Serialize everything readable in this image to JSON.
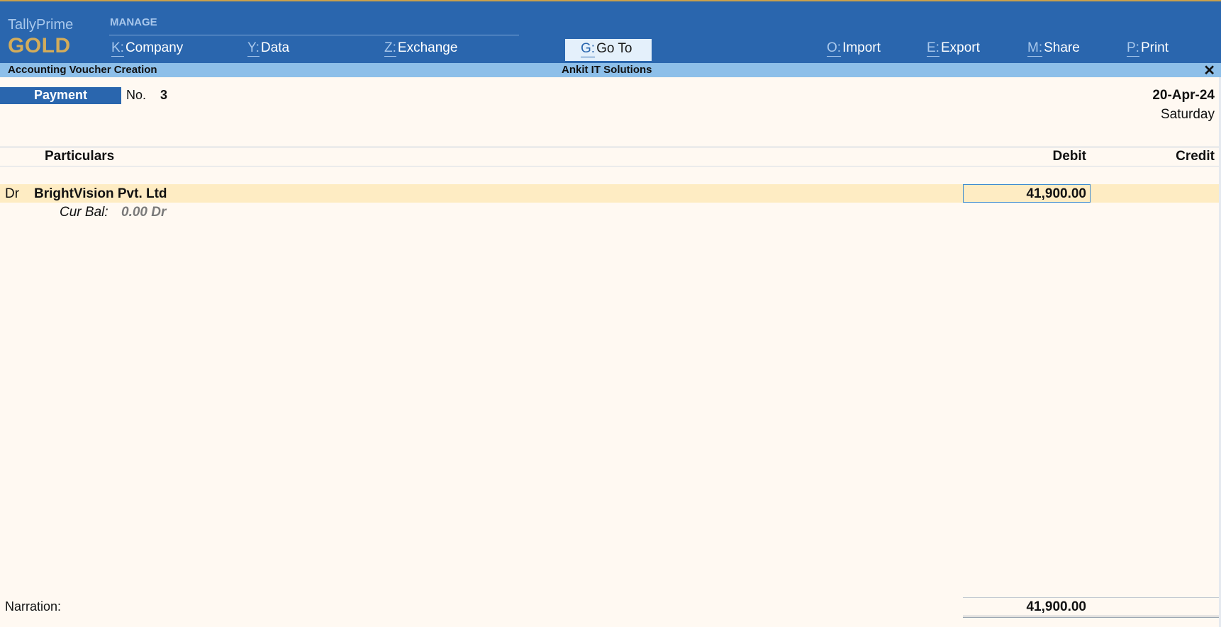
{
  "brand": {
    "product": "TallyPrime",
    "edition": "GOLD"
  },
  "menu": {
    "section": "MANAGE",
    "items": [
      {
        "key": "K:",
        "label": "Company"
      },
      {
        "key": "Y:",
        "label": "Data"
      },
      {
        "key": "Z:",
        "label": "Exchange"
      },
      {
        "key": "G:",
        "label": "Go To"
      },
      {
        "key": "O:",
        "label": "Import"
      },
      {
        "key": "E:",
        "label": "Export"
      },
      {
        "key": "M:",
        "label": "Share"
      },
      {
        "key": "P:",
        "label": "Print"
      }
    ]
  },
  "header": {
    "title": "Accounting Voucher Creation",
    "company": "Ankit IT Solutions"
  },
  "voucher": {
    "type": "Payment",
    "no_label": "No.",
    "no": "3",
    "date": "20-Apr-24",
    "day": "Saturday"
  },
  "table": {
    "col_particulars": "Particulars",
    "col_debit": "Debit",
    "col_credit": "Credit"
  },
  "entries": [
    {
      "drcr": "Dr",
      "ledger": "BrightVision Pvt. Ltd",
      "debit": "41,900.00",
      "cur_bal_label": "Cur Bal:",
      "cur_bal_value": "0.00 Dr"
    }
  ],
  "footer": {
    "narration_label": "Narration:",
    "total_debit": "41,900.00"
  },
  "colors": {
    "header_blue": "#2a66ae",
    "subbar_blue": "#8dbfe9",
    "gold": "#d3ac5a",
    "row_highlight": "#feecc3"
  }
}
